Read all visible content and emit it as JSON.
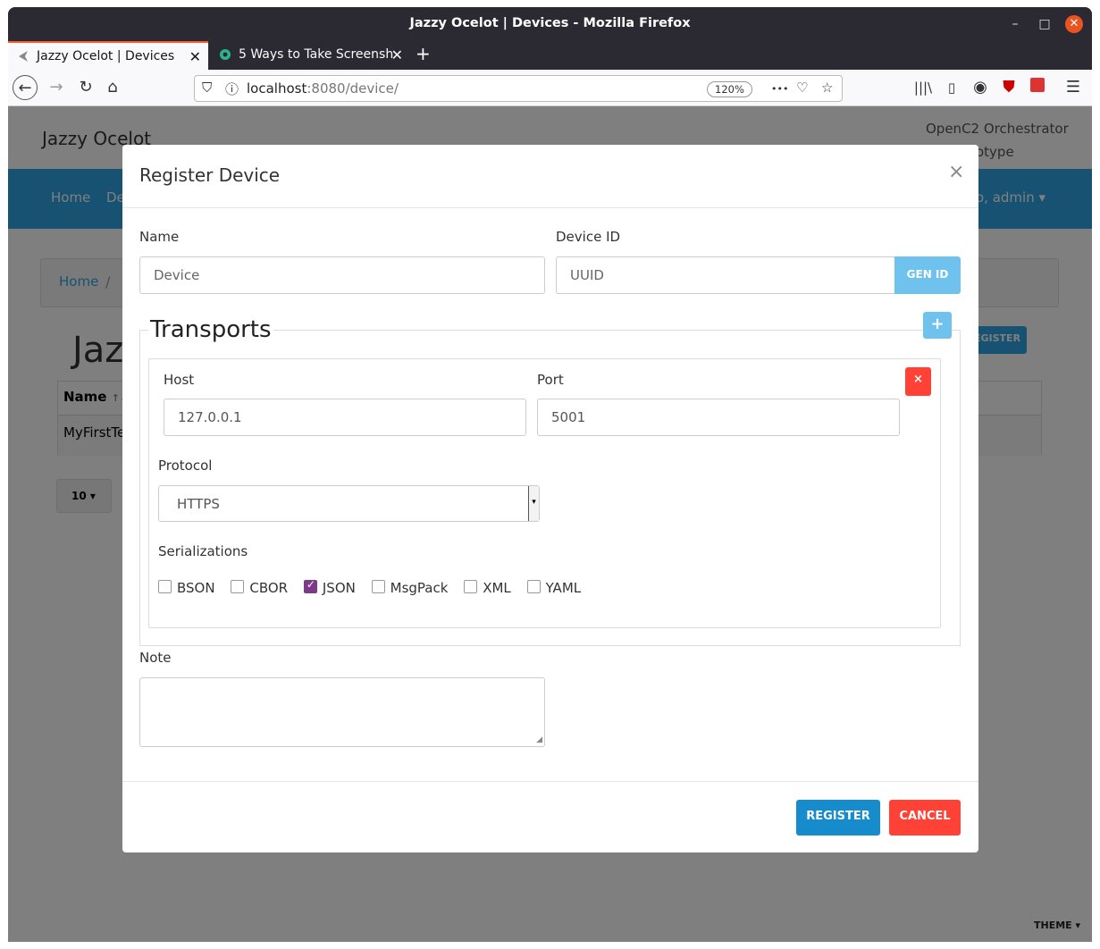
{
  "window": {
    "title": "Jazzy Ocelot | Devices - Mozilla Firefox",
    "minimize": "–",
    "maximize": "□",
    "close": "✕"
  },
  "tabs": [
    {
      "label": "Jazzy Ocelot | Devices",
      "close": "✕"
    },
    {
      "label": "5 Ways to Take Screensh",
      "close": "✕"
    }
  ],
  "newtab": "+",
  "nav": {
    "url_host": "localhost",
    "url_path": ":8080/device/",
    "zoom": "120%",
    "dots": "•••"
  },
  "page": {
    "brand": "Jazzy Ocelot",
    "subbrand_line1": "OpenC2 Orchestrator",
    "subbrand_line2": "otype",
    "nav_home": "Home",
    "nav_partial": "De",
    "nav_user": "o, admin ▾",
    "crumb_home": "Home",
    "crumb_sep": "/",
    "title_partial": "Jaz",
    "register_partial": "EGISTER",
    "table_name_header": "Name",
    "table_sort": "↑↓",
    "table_first_cell": "MyFirstTe",
    "pager_value": "10 ▾",
    "theme": "THEME ▾"
  },
  "modal": {
    "title": "Register Device",
    "close": "×",
    "name_label": "Name",
    "name_placeholder": "Device",
    "device_id_label": "Device ID",
    "device_id_placeholder": "UUID",
    "gen_id": "GEN ID",
    "transports_legend": "Transports",
    "add_transport": "+",
    "remove_transport": "×",
    "host_label": "Host",
    "host_value": "127.0.0.1",
    "port_label": "Port",
    "port_value": "5001",
    "protocol_label": "Protocol",
    "protocol_value": "HTTPS",
    "serializations_label": "Serializations",
    "serializations": [
      {
        "label": "BSON",
        "checked": false
      },
      {
        "label": "CBOR",
        "checked": false
      },
      {
        "label": "JSON",
        "checked": true
      },
      {
        "label": "MsgPack",
        "checked": false
      },
      {
        "label": "XML",
        "checked": false
      },
      {
        "label": "YAML",
        "checked": false
      }
    ],
    "note_label": "Note",
    "register": "REGISTER",
    "cancel": "CANCEL"
  },
  "colors": {
    "primary": "#2fa4e7",
    "info": "#6fc1ee",
    "danger": "#ff4136",
    "register_button": "#168ccc",
    "checkbox": "#7b3b86"
  }
}
